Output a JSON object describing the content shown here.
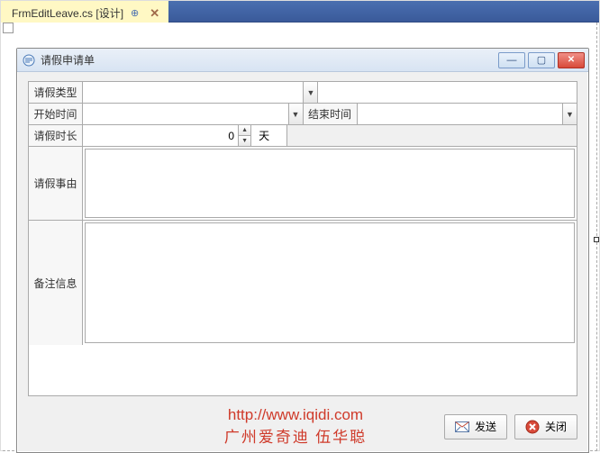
{
  "tab": {
    "label": "FrmEditLeave.cs [设计]"
  },
  "window": {
    "title": "请假申请单"
  },
  "labels": {
    "leaveType": "请假类型",
    "startTime": "开始时间",
    "endTime": "结束时间",
    "duration": "请假时长",
    "durationUnit": "天",
    "reason": "请假事由",
    "remark": "备注信息"
  },
  "values": {
    "leaveType": "",
    "startTime": "",
    "endTime": "",
    "duration": "0",
    "reason": "",
    "remark": ""
  },
  "watermark": {
    "url": "http://www.iqidi.com",
    "text": "广州爱奇迪  伍华聪"
  },
  "buttons": {
    "send": "发送",
    "close": "关闭"
  }
}
